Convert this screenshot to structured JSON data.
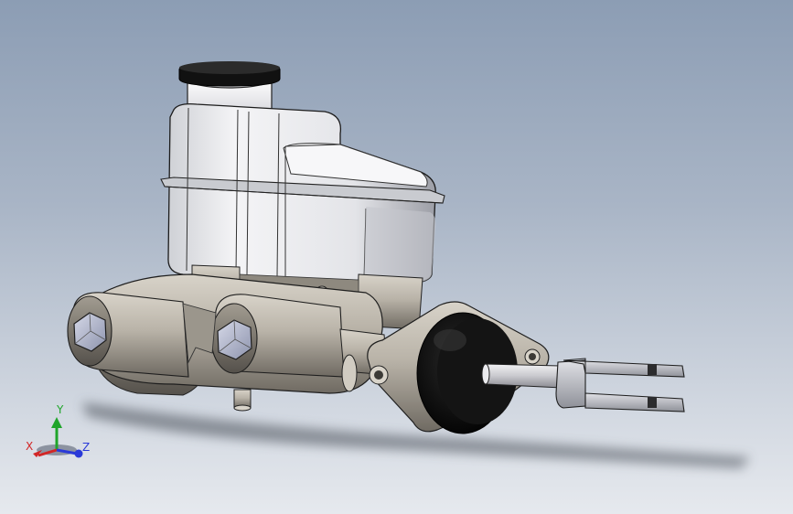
{
  "colors": {
    "background_top": "#8c9db4",
    "background_bottom": "#e6e9ee",
    "reservoir": "#e8e8ea",
    "body_metal": "#b7b1a6",
    "rubber": "#0c0c0c",
    "axis_x": "#d22626",
    "axis_y": "#1fa52a",
    "axis_z": "#2a3ad8"
  },
  "triad": {
    "x_label": "X",
    "y_label": "Y",
    "z_label": "Z"
  },
  "icons": [
    "coordinate-triad-icon"
  ]
}
